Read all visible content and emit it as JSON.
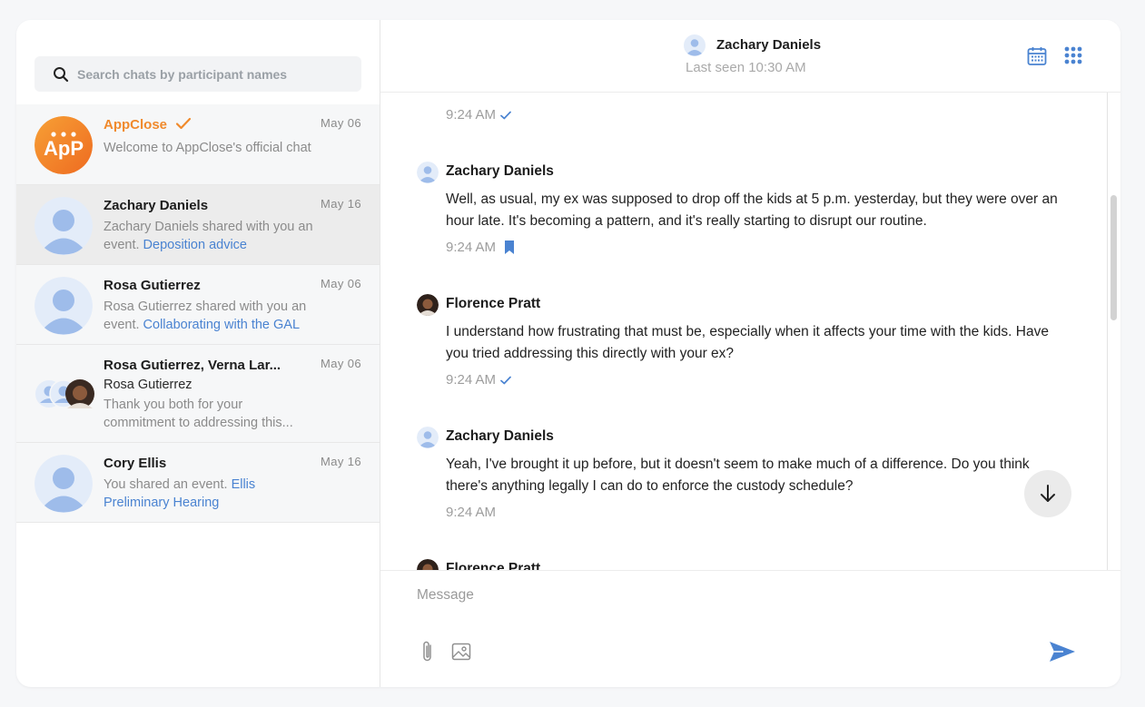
{
  "search": {
    "placeholder": "Search chats by participant names"
  },
  "chats": [
    {
      "name": "AppClose",
      "date": "May 06",
      "preview": "Welcome to AppClose's official chat",
      "avatar_text": "ApP"
    },
    {
      "name": "Zachary Daniels",
      "date": "May 16",
      "preview": "Zachary Daniels shared with you an event.",
      "link": "Deposition advice"
    },
    {
      "name": "Rosa Gutierrez",
      "date": "May 06",
      "preview": "Rosa Gutierrez shared with you an event.",
      "link": "Collaborating with the GAL"
    },
    {
      "name": "Rosa Gutierrez, Verna Lar...",
      "date": "May 06",
      "sender": "Rosa Gutierrez",
      "preview": "Thank you both for your commitment to addressing this..."
    },
    {
      "name": "Cory Ellis",
      "date": "May 16",
      "preview": "You shared an event.",
      "link": "Ellis Preliminary Hearing"
    }
  ],
  "header": {
    "name": "Zachary Daniels",
    "status": "Last seen 10:30 AM"
  },
  "messages": [
    {
      "time": "9:24 AM",
      "status_icon": "check-icon"
    },
    {
      "author": "Zachary Daniels",
      "text": "Well, as usual, my ex was supposed to drop off the kids at 5 p.m. yesterday, but they were over an hour late. It's becoming a pattern, and it's really starting to disrupt our routine.",
      "time": "9:24 AM",
      "status_icon": "bookmark-icon"
    },
    {
      "author": "Florence Pratt",
      "text": "I understand how frustrating that must be, especially when it affects your time with the kids. Have you tried addressing this directly with your ex?",
      "time": "9:24 AM",
      "status_icon": "check-icon"
    },
    {
      "author": "Zachary Daniels",
      "text": "Yeah, I've brought it up before, but it doesn't seem to make much of a difference. Do you think there's anything legally I can do to enforce the custody schedule?",
      "time": "9:24 AM"
    },
    {
      "author": "Florence Pratt"
    }
  ],
  "composer": {
    "placeholder": "Message"
  },
  "colors": {
    "brand": "#f08a2c",
    "accent": "#4a83d1",
    "avatar_bg": "#e3ecf9",
    "avatar_fg": "#9ebcea"
  }
}
